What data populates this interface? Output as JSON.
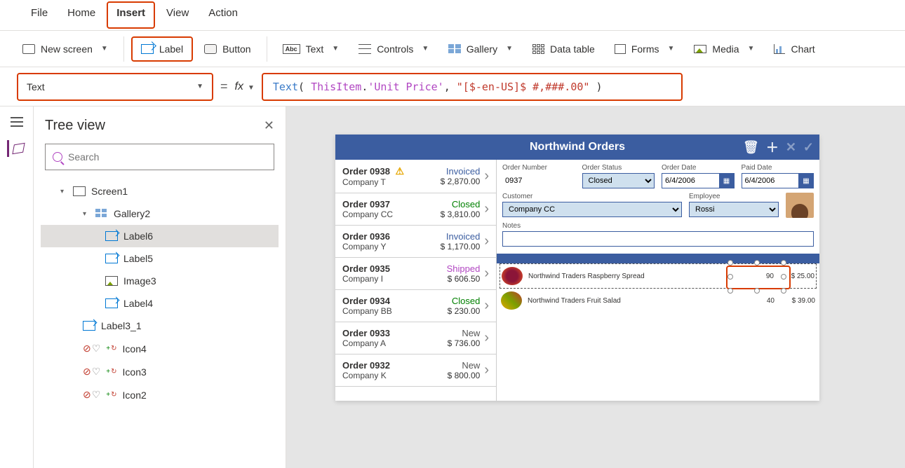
{
  "menus": {
    "file": "File",
    "home": "Home",
    "insert": "Insert",
    "view": "View",
    "action": "Action"
  },
  "ribbon": {
    "new_screen": "New screen",
    "label": "Label",
    "button": "Button",
    "text": "Text",
    "controls": "Controls",
    "gallery": "Gallery",
    "data_table": "Data table",
    "forms": "Forms",
    "media": "Media",
    "chart": "Chart"
  },
  "property_selector": "Text",
  "formula": {
    "fn": "Text",
    "open": "( ",
    "this": "ThisItem",
    "dot": ".",
    "field": "'Unit Price'",
    "sep": ", ",
    "fmt": "\"[$-en-US]$ #,###.00\"",
    "close": " )"
  },
  "tree": {
    "title": "Tree view",
    "search_placeholder": "Search",
    "items": {
      "screen1": "Screen1",
      "gallery2": "Gallery2",
      "label6": "Label6",
      "label5": "Label5",
      "image3": "Image3",
      "label4": "Label4",
      "label3_1": "Label3_1",
      "icon4": "Icon4",
      "icon3": "Icon3",
      "icon2": "Icon2"
    }
  },
  "app": {
    "title": "Northwind Orders",
    "orders": [
      {
        "id": "Order 0938",
        "warn": true,
        "company": "Company T",
        "status": "Invoiced",
        "status_cls": "st-invoiced",
        "price": "$ 2,870.00"
      },
      {
        "id": "Order 0937",
        "company": "Company CC",
        "status": "Closed",
        "status_cls": "st-closed",
        "price": "$ 3,810.00"
      },
      {
        "id": "Order 0936",
        "company": "Company Y",
        "status": "Invoiced",
        "status_cls": "st-invoiced",
        "price": "$ 1,170.00"
      },
      {
        "id": "Order 0935",
        "company": "Company I",
        "status": "Shipped",
        "status_cls": "st-shipped",
        "price": "$ 606.50"
      },
      {
        "id": "Order 0934",
        "company": "Company BB",
        "status": "Closed",
        "status_cls": "st-closed",
        "price": "$ 230.00"
      },
      {
        "id": "Order 0933",
        "company": "Company A",
        "status": "New",
        "status_cls": "st-new",
        "price": "$ 736.00"
      },
      {
        "id": "Order 0932",
        "company": "Company K",
        "status": "New",
        "status_cls": "st-new",
        "price": "$ 800.00"
      }
    ],
    "detail": {
      "labels": {
        "onum": "Order Number",
        "ostat": "Order Status",
        "odate": "Order Date",
        "pdate": "Paid Date",
        "cust": "Customer",
        "emp": "Employee",
        "notes": "Notes"
      },
      "order_number": "0937",
      "order_status": "Closed",
      "order_date": "6/4/2006",
      "paid_date": "6/4/2006",
      "customer": "Company CC",
      "employee": "Rossi"
    },
    "items": [
      {
        "img": "img-rasp",
        "name": "Northwind Traders Raspberry Spread",
        "qty": "90",
        "price": "I$ 25.00",
        "selected": true
      },
      {
        "img": "img-salad",
        "name": "Northwind Traders Fruit Salad",
        "qty": "40",
        "price": "$ 39.00",
        "selected": false
      }
    ]
  }
}
